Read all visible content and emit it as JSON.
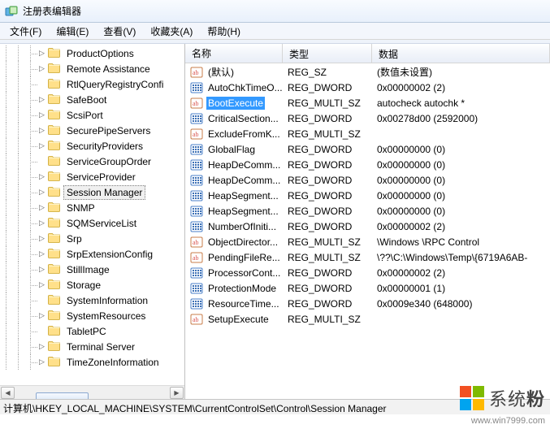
{
  "window": {
    "title": "注册表编辑器"
  },
  "menu": {
    "items": [
      "文件(F)",
      "编辑(E)",
      "查看(V)",
      "收藏夹(A)",
      "帮助(H)"
    ]
  },
  "tree": {
    "items": [
      {
        "label": "ProductOptions",
        "expandable": true
      },
      {
        "label": "Remote Assistance",
        "expandable": true
      },
      {
        "label": "RtlQueryRegistryConfi",
        "expandable": false
      },
      {
        "label": "SafeBoot",
        "expandable": true
      },
      {
        "label": "ScsiPort",
        "expandable": true
      },
      {
        "label": "SecurePipeServers",
        "expandable": true
      },
      {
        "label": "SecurityProviders",
        "expandable": true
      },
      {
        "label": "ServiceGroupOrder",
        "expandable": false
      },
      {
        "label": "ServiceProvider",
        "expandable": true
      },
      {
        "label": "Session Manager",
        "expandable": true,
        "selected": true
      },
      {
        "label": "SNMP",
        "expandable": true
      },
      {
        "label": "SQMServiceList",
        "expandable": true
      },
      {
        "label": "Srp",
        "expandable": true
      },
      {
        "label": "SrpExtensionConfig",
        "expandable": true
      },
      {
        "label": "StillImage",
        "expandable": true
      },
      {
        "label": "Storage",
        "expandable": true
      },
      {
        "label": "SystemInformation",
        "expandable": false
      },
      {
        "label": "SystemResources",
        "expandable": true
      },
      {
        "label": "TabletPC",
        "expandable": false
      },
      {
        "label": "Terminal Server",
        "expandable": true
      },
      {
        "label": "TimeZoneInformation",
        "expandable": true
      }
    ]
  },
  "list": {
    "columns": {
      "name": "名称",
      "type": "类型",
      "data": "数据"
    },
    "rows": [
      {
        "icon": "sz",
        "name": "(默认)",
        "type": "REG_SZ",
        "data": "(数值未设置)"
      },
      {
        "icon": "bin",
        "name": "AutoChkTimeO...",
        "type": "REG_DWORD",
        "data": "0x00000002 (2)"
      },
      {
        "icon": "sz",
        "name": "BootExecute",
        "type": "REG_MULTI_SZ",
        "data": "autocheck autochk *",
        "selected": true
      },
      {
        "icon": "bin",
        "name": "CriticalSection...",
        "type": "REG_DWORD",
        "data": "0x00278d00 (2592000)"
      },
      {
        "icon": "sz",
        "name": "ExcludeFromK...",
        "type": "REG_MULTI_SZ",
        "data": ""
      },
      {
        "icon": "bin",
        "name": "GlobalFlag",
        "type": "REG_DWORD",
        "data": "0x00000000 (0)"
      },
      {
        "icon": "bin",
        "name": "HeapDeComm...",
        "type": "REG_DWORD",
        "data": "0x00000000 (0)"
      },
      {
        "icon": "bin",
        "name": "HeapDeComm...",
        "type": "REG_DWORD",
        "data": "0x00000000 (0)"
      },
      {
        "icon": "bin",
        "name": "HeapSegment...",
        "type": "REG_DWORD",
        "data": "0x00000000 (0)"
      },
      {
        "icon": "bin",
        "name": "HeapSegment...",
        "type": "REG_DWORD",
        "data": "0x00000000 (0)"
      },
      {
        "icon": "bin",
        "name": "NumberOfIniti...",
        "type": "REG_DWORD",
        "data": "0x00000002 (2)"
      },
      {
        "icon": "sz",
        "name": "ObjectDirector...",
        "type": "REG_MULTI_SZ",
        "data": "\\Windows \\RPC Control"
      },
      {
        "icon": "sz",
        "name": "PendingFileRe...",
        "type": "REG_MULTI_SZ",
        "data": "\\??\\C:\\Windows\\Temp\\{6719A6AB-"
      },
      {
        "icon": "bin",
        "name": "ProcessorCont...",
        "type": "REG_DWORD",
        "data": "0x00000002 (2)"
      },
      {
        "icon": "bin",
        "name": "ProtectionMode",
        "type": "REG_DWORD",
        "data": "0x00000001 (1)"
      },
      {
        "icon": "bin",
        "name": "ResourceTime...",
        "type": "REG_DWORD",
        "data": "0x0009e340 (648000)"
      },
      {
        "icon": "sz",
        "name": "SetupExecute",
        "type": "REG_MULTI_SZ",
        "data": ""
      }
    ]
  },
  "status": {
    "path": "计算机\\HKEY_LOCAL_MACHINE\\SYSTEM\\CurrentControlSet\\Control\\Session Manager"
  },
  "watermark": {
    "brand_a": "系统",
    "brand_b": "粉",
    "url": "www.win7999.com"
  }
}
